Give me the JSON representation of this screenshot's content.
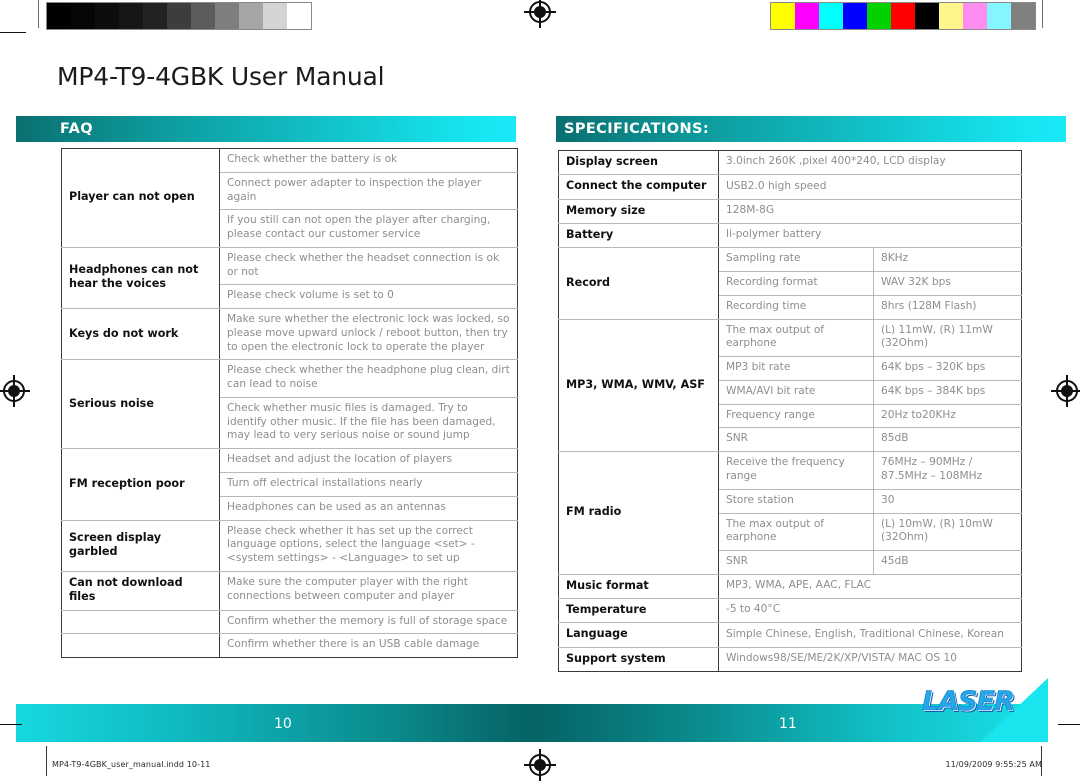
{
  "document": {
    "title": "MP4-T9-4GBK User Manual"
  },
  "sections": {
    "faq": {
      "heading": "FAQ"
    },
    "specifications": {
      "heading": "SPECIFICATIONS:"
    }
  },
  "faq_table": {
    "rows": [
      {
        "problem": "Player can not open",
        "span": 3,
        "solutions": [
          "Check whether the battery is ok",
          "Connect power adapter to inspection the player again",
          "If you still can not open the player after charging, please contact our customer service"
        ]
      },
      {
        "problem": "Headphones can not hear the voices",
        "span": 2,
        "solutions": [
          "Please check whether the headset connection is ok or not",
          "Please check volume is set to 0"
        ]
      },
      {
        "problem": "Keys do not work",
        "span": 1,
        "solutions": [
          "Make sure whether the electronic lock was locked, so please move upward unlock / reboot button, then try to open the electronic lock to operate the player"
        ]
      },
      {
        "problem": "Serious noise",
        "span": 2,
        "solutions": [
          "Please check whether the headphone plug clean, dirt can lead to noise",
          "Check whether music files is damaged. Try to identify other music. If the file has been damaged, may lead to very serious noise or sound jump"
        ]
      },
      {
        "problem": "FM reception poor",
        "span": 3,
        "solutions": [
          "Headset and adjust the location of players",
          "Turn off electrical installations nearly",
          "Headphones can be used as an antennas"
        ]
      },
      {
        "problem": "Screen display garbled",
        "span": 1,
        "solutions": [
          "Please check whether it has set up the correct language options, select the language <set> - <system settings> - <Language> to set up"
        ]
      },
      {
        "problem": "Can not download files",
        "span": 1,
        "solutions": [
          "Make sure the computer player with the right connections between computer and player"
        ]
      },
      {
        "problem": "",
        "span": 1,
        "solutions": [
          "Confirm whether the memory is full of storage space"
        ]
      },
      {
        "problem": "",
        "span": 1,
        "solutions": [
          "Confirm whether there is an USB cable damage"
        ]
      }
    ]
  },
  "spec_table": {
    "rows": [
      {
        "key": "Display screen",
        "value": "3.0inch 260K ,pixel 400*240, LCD display"
      },
      {
        "key": "Connect the computer",
        "value": "USB2.0 high speed"
      },
      {
        "key": "Memory size",
        "value": "128M-8G"
      },
      {
        "key": "Battery",
        "value": "li-polymer battery"
      },
      {
        "key": "Record",
        "subrows": [
          {
            "label": "Sampling rate",
            "value": "8KHz"
          },
          {
            "label": "Recording format",
            "value": "WAV 32K bps"
          },
          {
            "label": "Recording time",
            "value": "8hrs (128M Flash)"
          }
        ]
      },
      {
        "key": "MP3, WMA, WMV, ASF",
        "subrows": [
          {
            "label": "The max output of earphone",
            "value": "(L) 11mW, (R) 11mW (32Ohm)"
          },
          {
            "label": "MP3 bit rate",
            "value": "64K bps – 320K bps"
          },
          {
            "label": "WMA/AVI bit rate",
            "value": "64K bps – 384K bps"
          },
          {
            "label": "Frequency range",
            "value": "20Hz to20KHz"
          },
          {
            "label": "SNR",
            "value": "85dB"
          }
        ]
      },
      {
        "key": "FM radio",
        "subrows": [
          {
            "label": "Receive the frequency range",
            "value": "76MHz – 90MHz / 87.5MHz – 108MHz"
          },
          {
            "label": "Store station",
            "value": "30"
          },
          {
            "label": "The max output of earphone",
            "value": "(L) 10mW, (R) 10mW (32Ohm)"
          },
          {
            "label": "SNR",
            "value": "45dB"
          }
        ]
      },
      {
        "key": "Music format",
        "value": "MP3, WMA, APE, AAC, FLAC"
      },
      {
        "key": "Temperature",
        "value": "-5 to 40°C"
      },
      {
        "key": "Language",
        "value": "Simple Chinese, English, Traditional Chinese, Korean"
      },
      {
        "key": "Support system",
        "value": "Windows98/SE/ME/2K/XP/VISTA/ MAC OS 10"
      }
    ]
  },
  "footer": {
    "page_left": "10",
    "page_right": "11",
    "file_label": "MP4-T9-4GBK_user_manual.indd   10-11",
    "timestamp": "11/09/2009   9:55:25 AM",
    "logo_text": "LASER"
  },
  "calibration": {
    "gray_steps": [
      "#000000",
      "#060606",
      "#0d0d0d",
      "#161616",
      "#222222",
      "#3d3d3d",
      "#5c5c5c",
      "#7e7e7e",
      "#a6a6a6",
      "#d4d4d4",
      "#ffffff"
    ],
    "color_steps": [
      "#ffff00",
      "#ff00ff",
      "#00ffff",
      "#0000ff",
      "#00d200",
      "#ff0000",
      "#000000",
      "#fff68a",
      "#ff8cf0",
      "#85f6ff",
      "#808080"
    ]
  },
  "theme": {
    "accent_dark": "#066265",
    "accent_bright": "#1ae8f7",
    "logo_blue": "#22a7e8",
    "table_key_color": "#111111",
    "table_value_color": "#8e8e8e"
  }
}
